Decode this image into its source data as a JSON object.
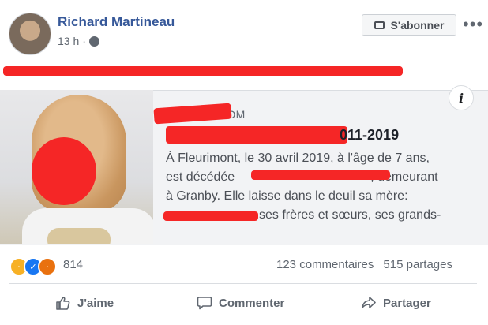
{
  "post": {
    "author": "Richard Martineau",
    "time": "13 h",
    "subscribe_label": "S'abonner",
    "more_label": "•••"
  },
  "link_card": {
    "domain": "SELEIOR.COM",
    "title_fragment": "011-2019",
    "description_lines": [
      "À Fleurimont, le 30 avril 2019, à l'âge de 7 ans,",
      "est décédée",
      ", demeurant",
      "à Granby. Elle laisse dans le deuil sa mère:",
      "ses frères et sœurs, ses grands-"
    ]
  },
  "stats": {
    "reactions_count": "814",
    "comments": "123 commentaires",
    "shares": "515 partages"
  },
  "actions": {
    "like": "J'aime",
    "comment": "Commenter",
    "share": "Partager"
  }
}
